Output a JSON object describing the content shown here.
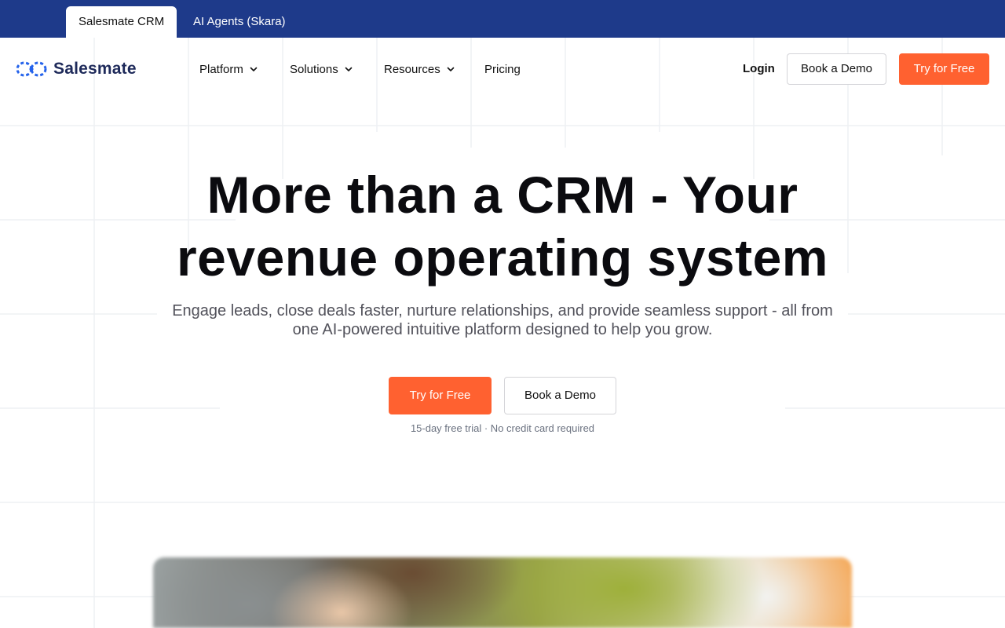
{
  "top_tabs": {
    "active": "Salesmate CRM",
    "inactive": "AI Agents (Skara)"
  },
  "nav": {
    "brand": "Salesmate",
    "menu": [
      {
        "label": "Platform",
        "has_dropdown": true
      },
      {
        "label": "Solutions",
        "has_dropdown": true
      },
      {
        "label": "Resources",
        "has_dropdown": true
      },
      {
        "label": "Pricing",
        "has_dropdown": false
      }
    ],
    "login_label": "Login",
    "book_demo_label": "Book a Demo",
    "try_free_label": "Try for Free"
  },
  "hero": {
    "title_line1": "More than a CRM - Your",
    "title_line2": "revenue operating system",
    "subtitle_line1": "Engage leads, close deals faster, nurture relationships, and provide seamless support - all from",
    "subtitle_line2": "one AI-powered intuitive platform designed to help you grow.",
    "cta_primary": "Try for Free",
    "cta_secondary": "Book a Demo",
    "note": "15-day free trial · No credit card required"
  },
  "colors": {
    "top_bar": "#1e3a8a",
    "accent_orange": "#ff6130",
    "brand_blue": "#2563eb",
    "brand_text": "#1e2a5a"
  },
  "icons": {
    "logo": "salesmate-logo-icon",
    "dropdown": "chevron-down-icon"
  }
}
